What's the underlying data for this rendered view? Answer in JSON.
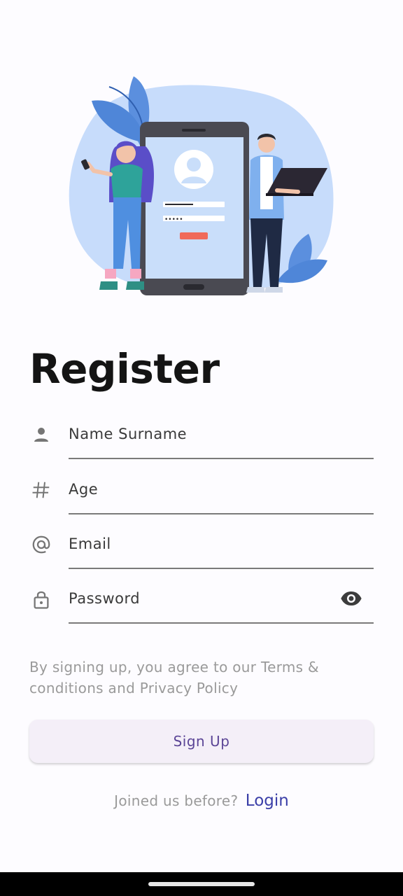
{
  "register": {
    "title": "Register"
  },
  "fields": {
    "name": {
      "placeholder": "Name Surname",
      "icon": "person-icon"
    },
    "age": {
      "placeholder": "Age",
      "icon": "hash-icon"
    },
    "email": {
      "placeholder": "Email",
      "icon": "at-icon"
    },
    "password": {
      "placeholder": "Password",
      "icon": "lock-icon",
      "toggle_icon": "eye-icon"
    }
  },
  "terms_text": "By signing up, you agree to our Terms & conditions and Privacy Policy",
  "signup": {
    "label": "Sign Up"
  },
  "login_prompt": {
    "question": "Joined us before?",
    "link_label": "Login"
  },
  "colors": {
    "accent": "#5b4596",
    "link": "#3b3fa8",
    "button_bg": "#f4eff8",
    "illustration_blob": "#c7dcfb"
  }
}
